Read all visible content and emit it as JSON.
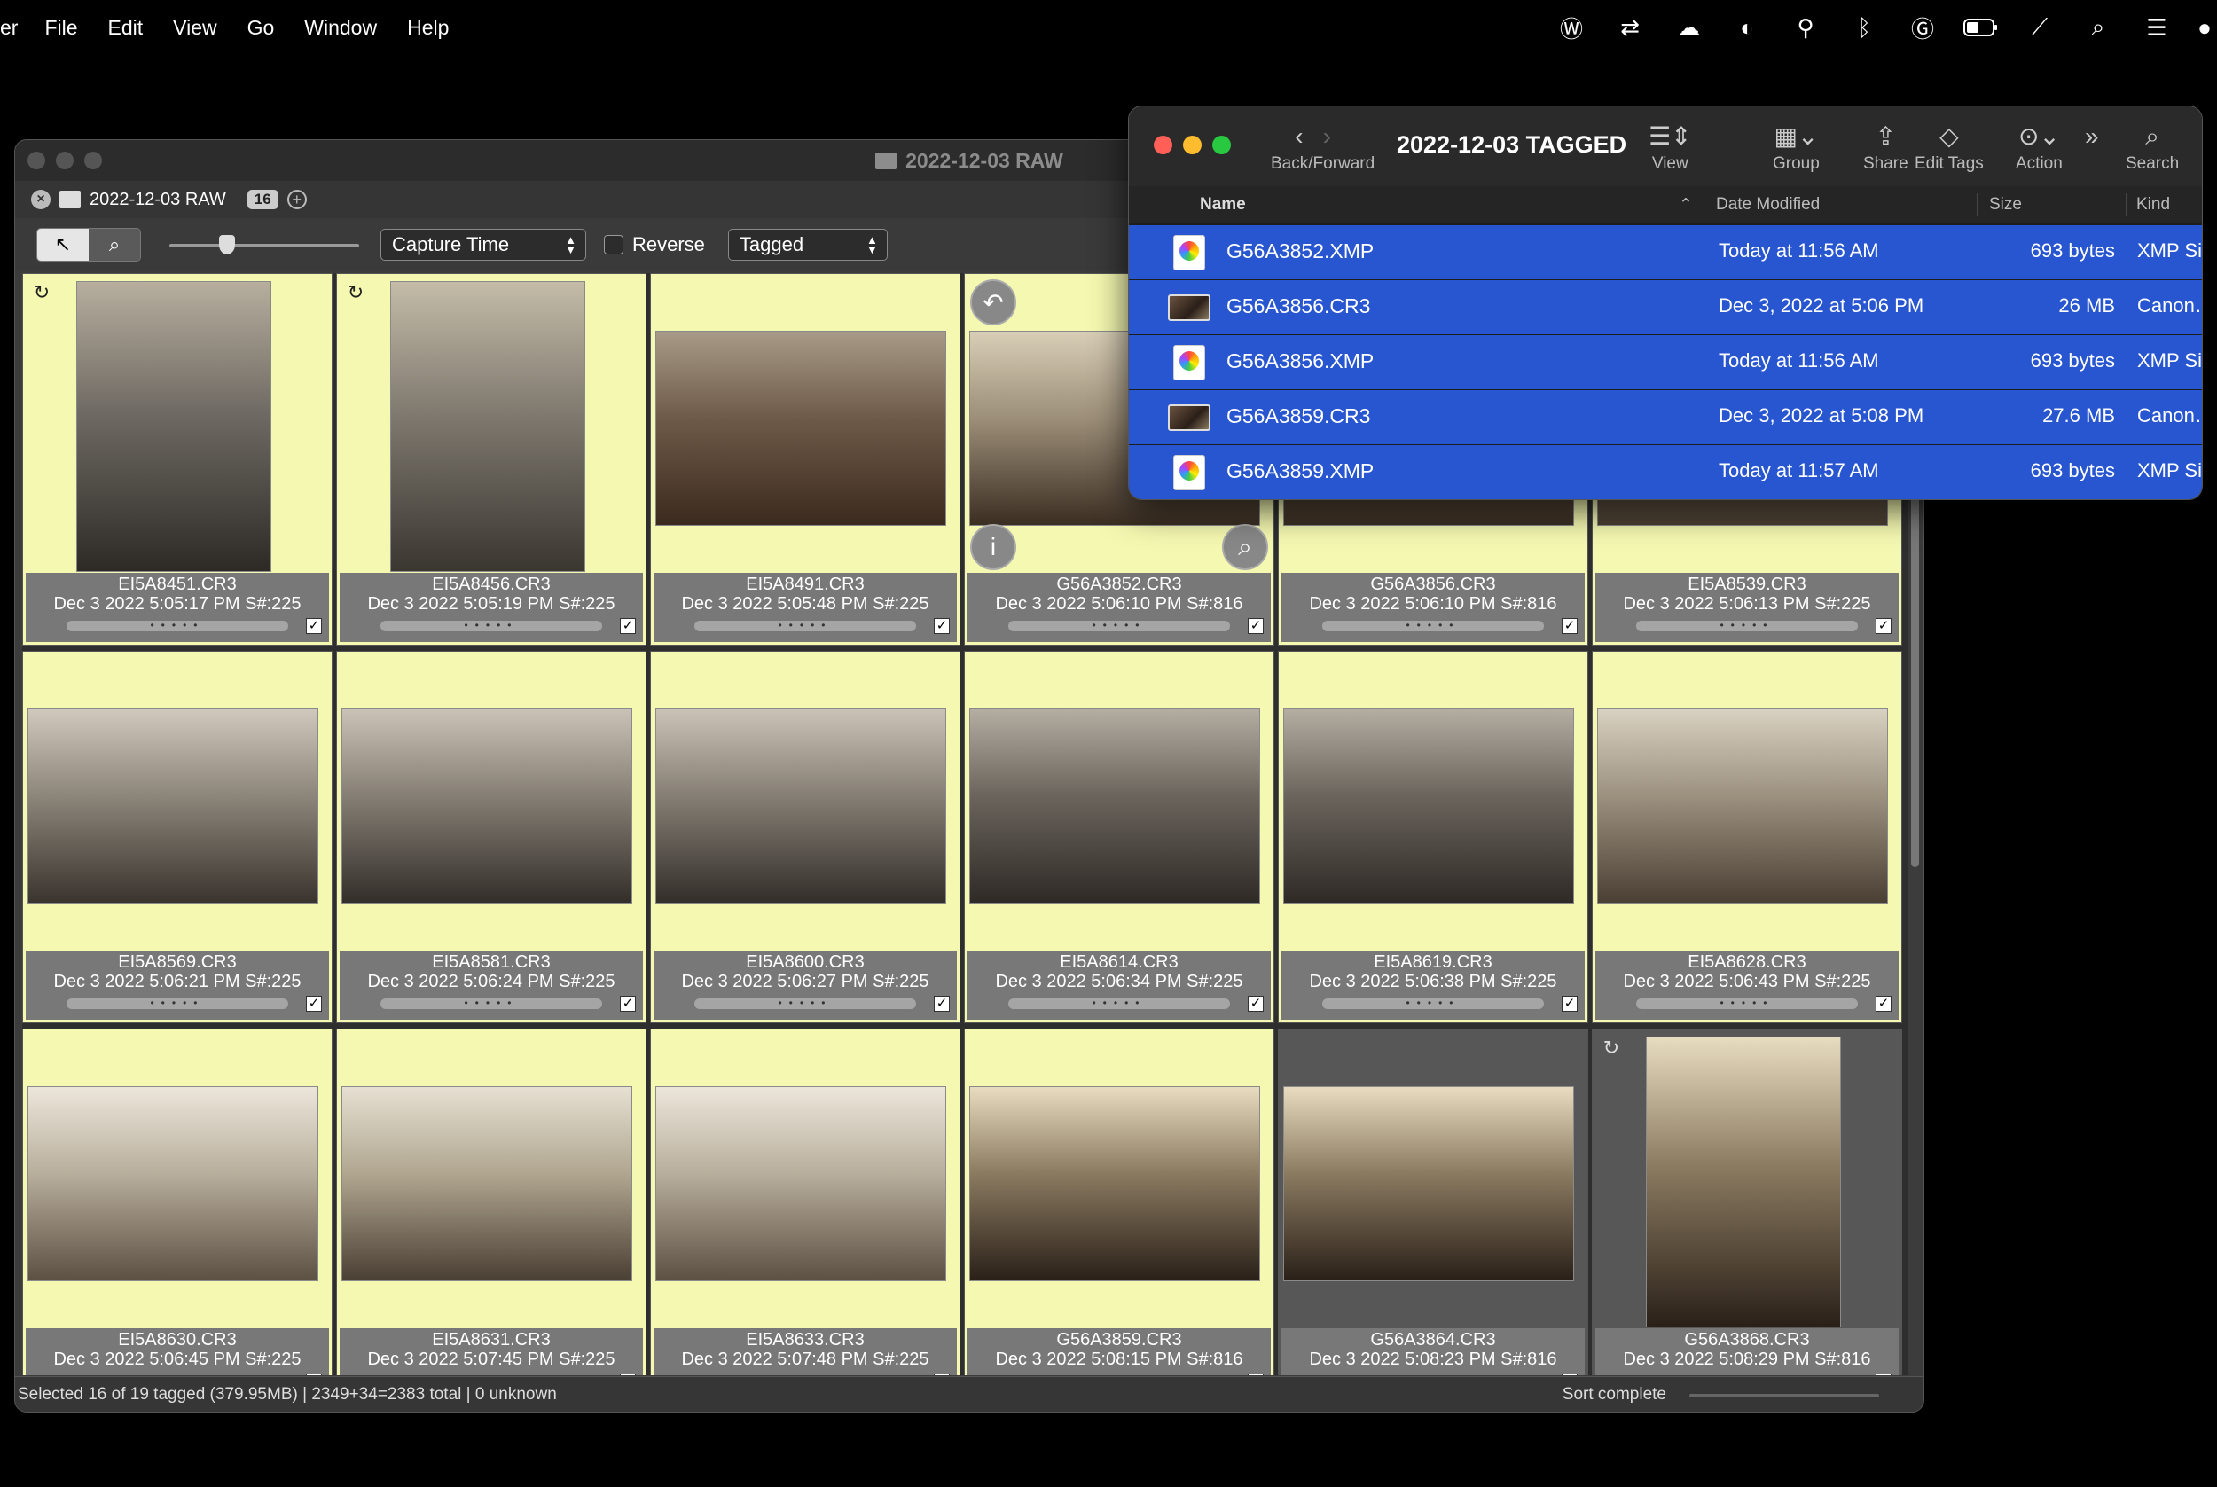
{
  "menubar": {
    "app_fragment": "er",
    "items": [
      "File",
      "Edit",
      "View",
      "Go",
      "Window",
      "Help"
    ]
  },
  "photomechanic": {
    "window_title": "2022-12-03 RAW",
    "tab_label": "2022-12-03 RAW",
    "tab_count": "16",
    "sort_select": "Capture Time",
    "reverse_label": "Reverse",
    "filter_select": "Tagged",
    "status_left": "Selected 16 of 19 tagged (379.95MB) | 2349+34=2383 total | 0 unknown",
    "status_right": "Sort complete",
    "thumbnails": [
      {
        "name": "EI5A8451.CR3",
        "date": "Dec 3 2022 5:05:17 PM S#:225"
      },
      {
        "name": "EI5A8456.CR3",
        "date": "Dec 3 2022 5:05:19 PM S#:225"
      },
      {
        "name": "EI5A8491.CR3",
        "date": "Dec 3 2022 5:05:48 PM S#:225"
      },
      {
        "name": "G56A3852.CR3",
        "date": "Dec 3 2022 5:06:10 PM S#:816"
      },
      {
        "name": "G56A3856.CR3",
        "date": "Dec 3 2022 5:06:10 PM S#:816"
      },
      {
        "name": "EI5A8539.CR3",
        "date": "Dec 3 2022 5:06:13 PM S#:225"
      },
      {
        "name": "EI5A8569.CR3",
        "date": "Dec 3 2022 5:06:21 PM S#:225"
      },
      {
        "name": "EI5A8581.CR3",
        "date": "Dec 3 2022 5:06:24 PM S#:225"
      },
      {
        "name": "EI5A8600.CR3",
        "date": "Dec 3 2022 5:06:27 PM S#:225"
      },
      {
        "name": "EI5A8614.CR3",
        "date": "Dec 3 2022 5:06:34 PM S#:225"
      },
      {
        "name": "EI5A8619.CR3",
        "date": "Dec 3 2022 5:06:38 PM S#:225"
      },
      {
        "name": "EI5A8628.CR3",
        "date": "Dec 3 2022 5:06:43 PM S#:225"
      },
      {
        "name": "EI5A8630.CR3",
        "date": "Dec 3 2022 5:06:45 PM S#:225"
      },
      {
        "name": "EI5A8631.CR3",
        "date": "Dec 3 2022 5:07:45 PM S#:225"
      },
      {
        "name": "EI5A8633.CR3",
        "date": "Dec 3 2022 5:07:48 PM S#:225"
      },
      {
        "name": "G56A3859.CR3",
        "date": "Dec 3 2022 5:08:15 PM S#:816"
      },
      {
        "name": "G56A3864.CR3",
        "date": "Dec 3 2022 5:08:23 PM S#:816"
      },
      {
        "name": "G56A3868.CR3",
        "date": "Dec 3 2022 5:08:29 PM S#:816"
      }
    ]
  },
  "finder": {
    "title": "2022-12-03 TAGGED",
    "buttons": {
      "back_forward": "Back/Forward",
      "view": "View",
      "group": "Group",
      "share": "Share",
      "edit_tags": "Edit Tags",
      "action": "Action",
      "search": "Search"
    },
    "columns": {
      "name": "Name",
      "date": "Date Modified",
      "size": "Size",
      "kind": "Kind"
    },
    "rows": [
      {
        "name": "G56A3852.XMP",
        "date": "Today at 11:56 AM",
        "size": "693 bytes",
        "kind": "XMP Si"
      },
      {
        "name": "G56A3856.CR3",
        "date": "Dec 3, 2022 at 5:06 PM",
        "size": "26 MB",
        "kind": "Canon…"
      },
      {
        "name": "G56A3856.XMP",
        "date": "Today at 11:56 AM",
        "size": "693 bytes",
        "kind": "XMP Si"
      },
      {
        "name": "G56A3859.CR3",
        "date": "Dec 3, 2022 at 5:08 PM",
        "size": "27.6 MB",
        "kind": "Canon…"
      },
      {
        "name": "G56A3859.XMP",
        "date": "Today at 11:57 AM",
        "size": "693 bytes",
        "kind": "XMP Si"
      }
    ]
  },
  "colors": {
    "tagged_cell": "#f4f8b0",
    "untagged_cell": "#575757",
    "finder_selection": "#2856d0"
  }
}
